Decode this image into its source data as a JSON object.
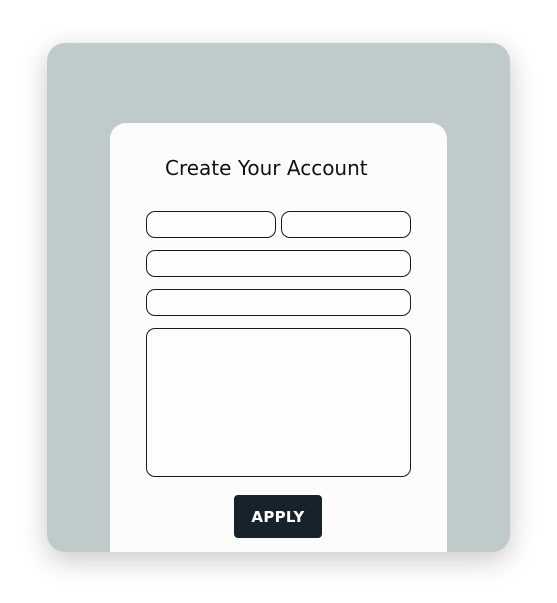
{
  "form": {
    "title": "Create Your Account",
    "fields": {
      "first_name": {
        "value": "",
        "placeholder": ""
      },
      "last_name": {
        "value": "",
        "placeholder": ""
      },
      "email": {
        "value": "",
        "placeholder": ""
      },
      "phone": {
        "value": "",
        "placeholder": ""
      },
      "message": {
        "value": "",
        "placeholder": ""
      }
    },
    "submit_label": "APPLY"
  },
  "colors": {
    "outer_background": "#bfcaca",
    "card_background": "#fcfcfc",
    "button_background": "#17232b",
    "button_text": "#ffffff",
    "field_border": "#1a1a1a"
  }
}
